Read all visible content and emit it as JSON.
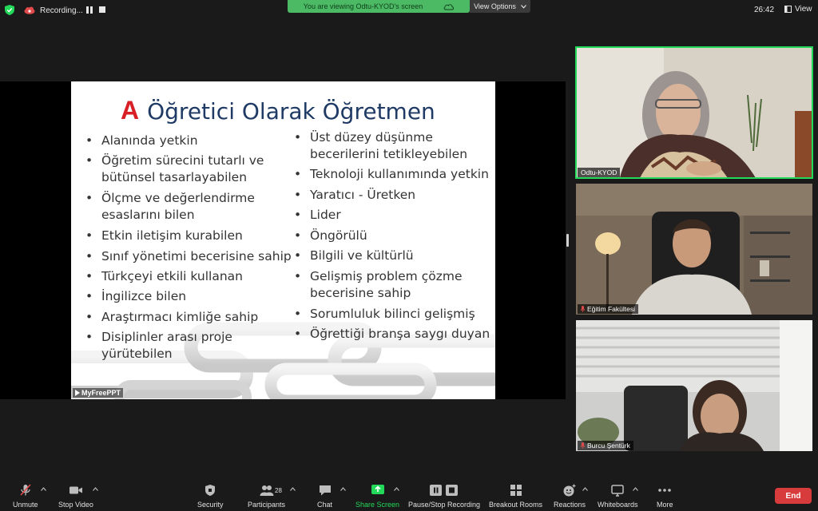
{
  "top_bar": {
    "recording_label": "Recording...",
    "viewing_banner": "You are viewing Odtu-KYOD's screen",
    "view_options_label": "View Options",
    "timer": "26:42",
    "view_label": "View"
  },
  "slide": {
    "title_letter": "A",
    "title": "Öğretici Olarak Öğretmen",
    "left_bullets": [
      "Alanında yetkin",
      "Öğretim sürecini tutarlı ve bütünsel tasarlayabilen",
      "Ölçme ve değerlendirme esaslarını bilen",
      "Etkin iletişim kurabilen",
      "Sınıf yönetimi becerisine sahip",
      "Türkçeyi etkili kullanan",
      "İngilizce bilen",
      "Araştırmacı kimliğe sahip",
      "Disiplinler arası proje yürütebilen"
    ],
    "right_bullets": [
      "Üst düzey düşünme becerilerini tetikleyebilen",
      "Teknoloji kullanımında yetkin",
      "Yaratıcı - Üretken",
      "Lider",
      "Öngörülü",
      "Bilgili ve kültürlü",
      "Gelişmiş problem çözme becerisine sahip",
      "Sorumluluk bilinci gelişmiş",
      "Öğrettiği branşa saygı duyan"
    ],
    "watermark": "MyFreePPT"
  },
  "participants": [
    {
      "name": "Odtu-KYOD",
      "muted": false
    },
    {
      "name": "Eğitim Fakültesi",
      "muted": true
    },
    {
      "name": "Burcu Şentürk",
      "muted": true
    }
  ],
  "toolbar": {
    "unmute": "Unmute",
    "stop_video": "Stop Video",
    "security": "Security",
    "participants": "Participants",
    "participants_count": "28",
    "chat": "Chat",
    "share_screen": "Share Screen",
    "pause_stop_recording": "Pause/Stop Recording",
    "breakout_rooms": "Breakout Rooms",
    "reactions": "Reactions",
    "whiteboards": "Whiteboards",
    "more": "More",
    "end": "End"
  },
  "colors": {
    "active_speaker": "#23d959",
    "banner_green": "#4cba64",
    "end_red": "#d83b3b",
    "title_blue": "#1f3a64",
    "title_letter_red": "#d81f26"
  }
}
